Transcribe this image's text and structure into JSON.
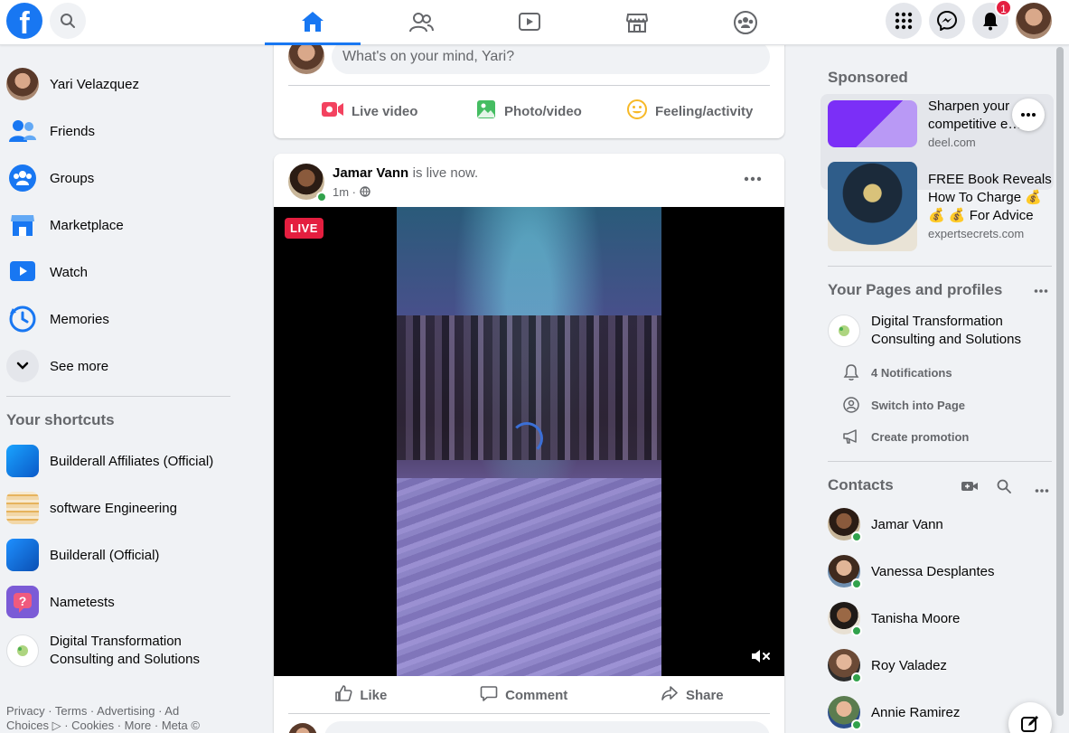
{
  "header": {
    "logo": "f",
    "notification_count": "1"
  },
  "user": {
    "name": "Yari Velazquez",
    "first_name": "Yari"
  },
  "left_nav": {
    "items": [
      {
        "label": "Yari Velazquez"
      },
      {
        "label": "Friends"
      },
      {
        "label": "Groups"
      },
      {
        "label": "Marketplace"
      },
      {
        "label": "Watch"
      },
      {
        "label": "Memories"
      },
      {
        "label": "See more"
      }
    ],
    "shortcuts_title": "Your shortcuts",
    "shortcuts": [
      {
        "label": "Builderall Affiliates (Official)"
      },
      {
        "label": "software Engineering"
      },
      {
        "label": "Builderall (Official)"
      },
      {
        "label": "Nametests"
      },
      {
        "label": "Digital Transformation Consulting and Solutions"
      }
    ],
    "footer": "Privacy · Terms · Advertising · Ad Choices ▷ · Cookies · More · Meta ©"
  },
  "composer": {
    "placeholder": "What's on your mind, Yari?",
    "live_video": "Live video",
    "photo_video": "Photo/video",
    "feeling": "Feeling/activity"
  },
  "post": {
    "author": "Jamar Vann",
    "status": "is live now.",
    "time": "1m ·",
    "live_badge": "LIVE",
    "like": "Like",
    "comment": "Comment",
    "share": "Share"
  },
  "right": {
    "sponsored_title": "Sponsored",
    "ads": [
      {
        "title": "Sharpen your competitive e…",
        "domain": "deel.com"
      },
      {
        "title": "FREE Book Reveals How To Charge 💰 💰 💰 For Advice",
        "domain": "expertsecrets.com"
      }
    ],
    "pages_title": "Your Pages and profiles",
    "page_name": "Digital Transformation Consulting and Solutions",
    "page_actions": [
      {
        "label": "4 Notifications"
      },
      {
        "label": "Switch into Page"
      },
      {
        "label": "Create promotion"
      }
    ],
    "contacts_title": "Contacts",
    "contacts": [
      {
        "name": "Jamar Vann"
      },
      {
        "name": "Vanessa Desplantes"
      },
      {
        "name": "Tanisha Moore"
      },
      {
        "name": "Roy Valadez"
      },
      {
        "name": "Annie Ramirez"
      }
    ]
  },
  "colors": {
    "brand": "#1877f2",
    "live": "#e41e3f",
    "online": "#31a24c"
  }
}
